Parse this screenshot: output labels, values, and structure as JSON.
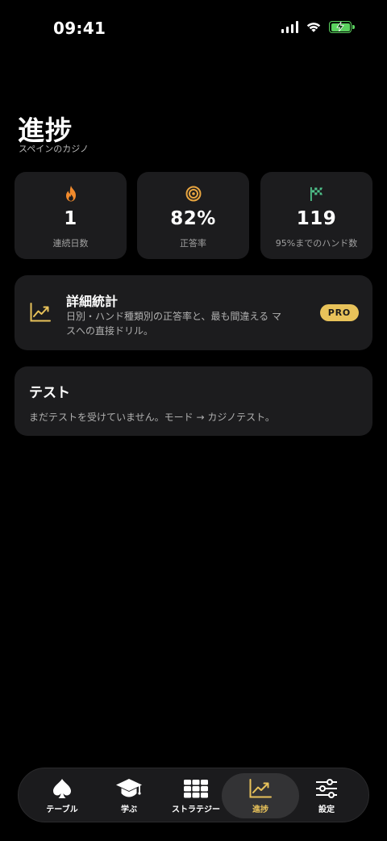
{
  "status_bar": {
    "time": "09:41"
  },
  "header": {
    "title": "進捗",
    "subtitle": "スペインのカジノ"
  },
  "stats": [
    {
      "icon": "flame-icon",
      "value": "1",
      "label": "連続日数",
      "color": "#f08a2c"
    },
    {
      "icon": "target-icon",
      "value": "82%",
      "label": "正答率",
      "color": "#e8a540"
    },
    {
      "icon": "checkered-flag-icon",
      "value": "119",
      "label": "95%までのハンド数",
      "color": "#4fc08a"
    }
  ],
  "detail_card": {
    "icon": "trend-chart-icon",
    "title": "詳細統計",
    "description": "日別・ハンド種類別の正答率と、最も間違える マスへの直接ドリル。",
    "badge": "PRO"
  },
  "test_card": {
    "title": "テスト",
    "description": "まだテストを受けていません。モード → カジノテスト。"
  },
  "tab_bar": {
    "items": [
      {
        "icon": "spade-icon",
        "label": "テーブル",
        "active": false
      },
      {
        "icon": "graduation-cap-icon",
        "label": "学ぶ",
        "active": false
      },
      {
        "icon": "grid-icon",
        "label": "ストラテジー",
        "active": false
      },
      {
        "icon": "trend-chart-icon",
        "label": "進捗",
        "active": true
      },
      {
        "icon": "sliders-icon",
        "label": "設定",
        "active": false
      }
    ]
  },
  "colors": {
    "accent": "#e8c25a",
    "card_bg": "#1c1c1e",
    "background": "#000000"
  }
}
